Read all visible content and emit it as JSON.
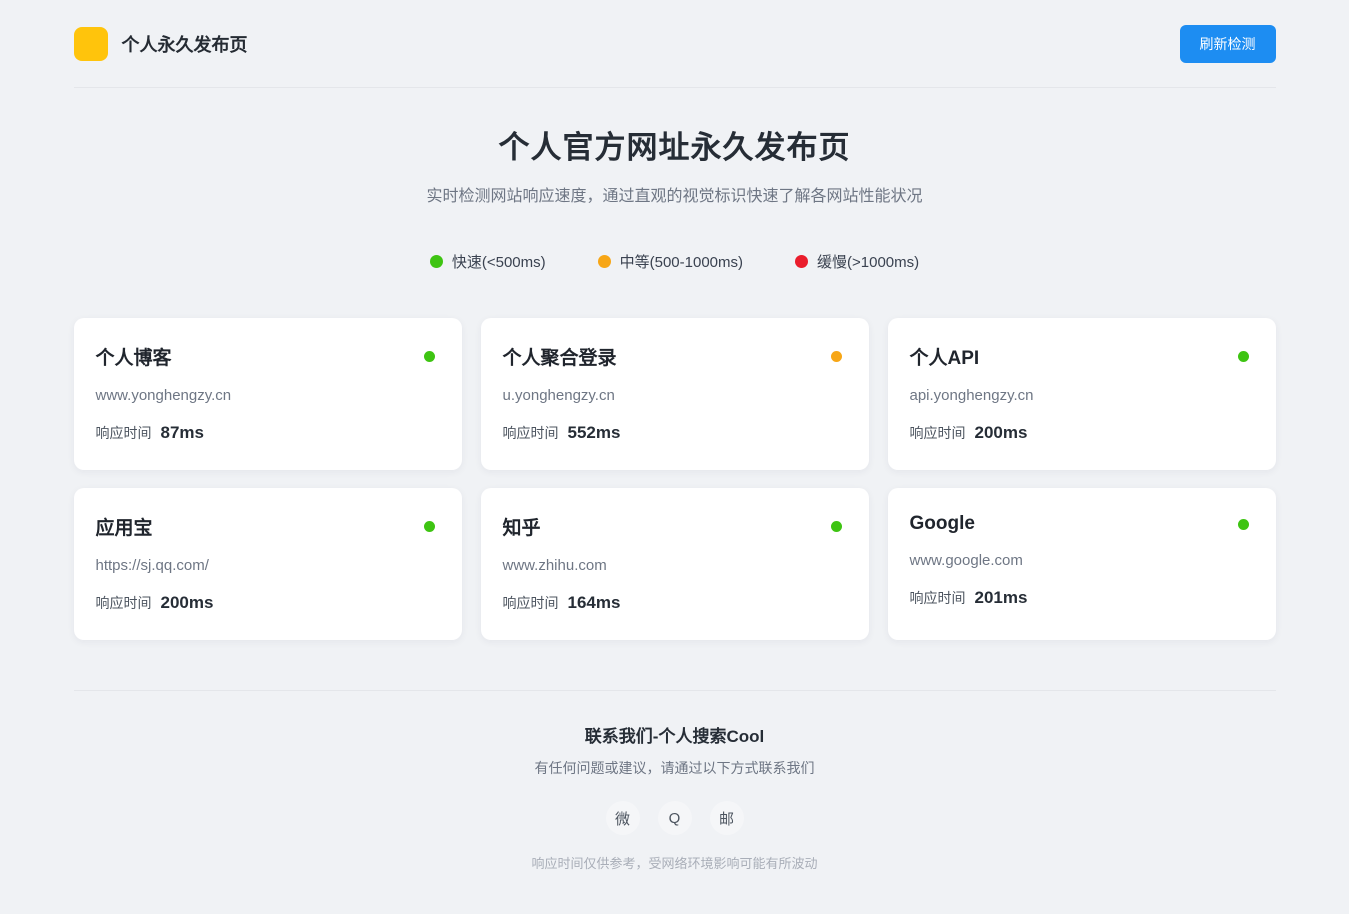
{
  "header": {
    "logo_color": "#ffc40c",
    "title": "个人永久发布页",
    "refresh_button": "刷新检测",
    "button_color": "#1d8df2"
  },
  "hero": {
    "title": "个人官方网址永久发布页",
    "subtitle": "实时检测网站响应速度，通过直观的视觉标识快速了解各网站性能状况"
  },
  "legend": {
    "items": [
      {
        "label": "快速(<500ms)",
        "color": "#3ec412"
      },
      {
        "label": "中等(500-1000ms)",
        "color": "#f7a616"
      },
      {
        "label": "缓慢(>1000ms)",
        "color": "#ea1d2c"
      }
    ]
  },
  "sites": {
    "response_label": "响应时间",
    "cards": [
      {
        "name": "个人博客",
        "url": "www.yonghengzy.cn",
        "response": "87ms",
        "status": "fast",
        "status_color": "#3ec412"
      },
      {
        "name": "个人聚合登录",
        "url": "u.yonghengzy.cn",
        "response": "552ms",
        "status": "medium",
        "status_color": "#f7a616"
      },
      {
        "name": "个人API",
        "url": "api.yonghengzy.cn",
        "response": "200ms",
        "status": "fast",
        "status_color": "#3ec412"
      },
      {
        "name": "应用宝",
        "url": "https://sj.qq.com/",
        "response": "200ms",
        "status": "fast",
        "status_color": "#3ec412"
      },
      {
        "name": "知乎",
        "url": "www.zhihu.com",
        "response": "164ms",
        "status": "fast",
        "status_color": "#3ec412"
      },
      {
        "name": "Google",
        "url": "www.google.com",
        "response": "201ms",
        "status": "fast",
        "status_color": "#3ec412"
      }
    ]
  },
  "footer": {
    "title": "联系我们-个人搜索Cool",
    "subtitle": "有任何问题或建议，请通过以下方式联系我们",
    "contacts": [
      {
        "name": "wechat-icon",
        "glyph": "微"
      },
      {
        "name": "qq-icon",
        "glyph": "Q"
      },
      {
        "name": "mail-icon",
        "glyph": "邮"
      }
    ],
    "disclaimer": "响应时间仅供参考，受网络环境影响可能有所波动"
  }
}
